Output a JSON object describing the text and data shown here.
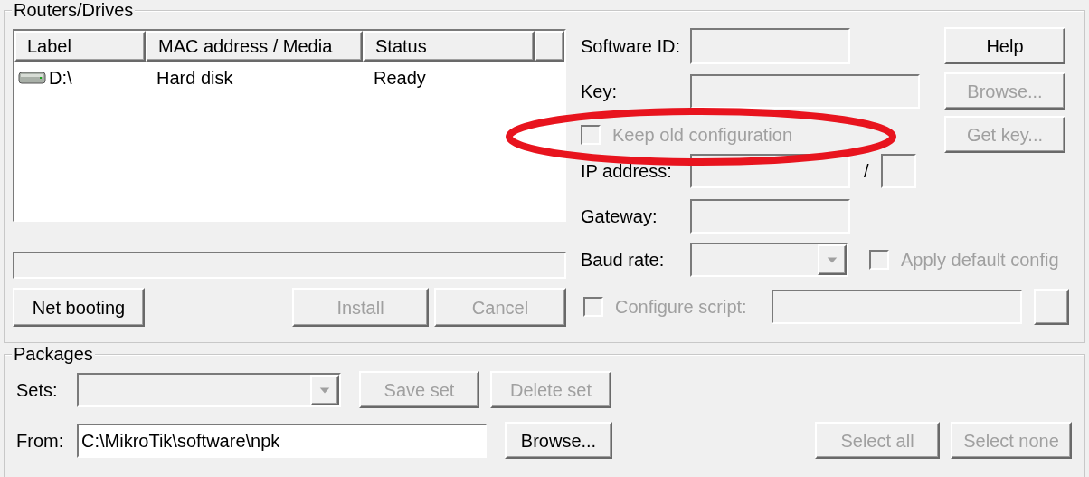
{
  "routers_drives": {
    "title": "Routers/Drives",
    "columns": [
      "Label",
      "MAC address / Media",
      "Status"
    ],
    "rows": [
      {
        "label": "D:\\",
        "media": "Hard disk",
        "status": "Ready"
      }
    ],
    "buttons": [
      {
        "label": "Net booting",
        "disabled": false
      },
      {
        "label": "Install",
        "disabled": true
      },
      {
        "label": "Cancel",
        "disabled": true
      }
    ],
    "software_id": {
      "label": "Software ID:"
    },
    "key": {
      "label": "Key:"
    },
    "keep_old_configuration": {
      "label": "Keep old configuration",
      "checked": false,
      "disabled": true
    },
    "ip_address": {
      "label": "IP address:",
      "separator": "/"
    },
    "gateway": {
      "label": "Gateway:"
    },
    "baud_rate": {
      "label": "Baud rate:"
    },
    "apply_default_config": {
      "label": "Apply default config",
      "checked": false,
      "disabled": true
    },
    "configure_script": {
      "label": "Configure script:",
      "checked": false,
      "disabled": true
    },
    "side_buttons": [
      {
        "label": "Help",
        "disabled": false
      },
      {
        "label": "Browse...",
        "disabled": true
      },
      {
        "label": "Get key...",
        "disabled": true
      }
    ]
  },
  "packages": {
    "title": "Packages",
    "sets_label": "Sets:",
    "from_label": "From:",
    "from_value": "C:\\MikroTik\\software\\npk",
    "buttons": [
      {
        "label": "Save set",
        "disabled": true
      },
      {
        "label": "Delete set",
        "disabled": true
      },
      {
        "label": "Browse...",
        "disabled": false
      },
      {
        "label": "Select all",
        "disabled": true
      },
      {
        "label": "Select none",
        "disabled": true
      }
    ]
  }
}
